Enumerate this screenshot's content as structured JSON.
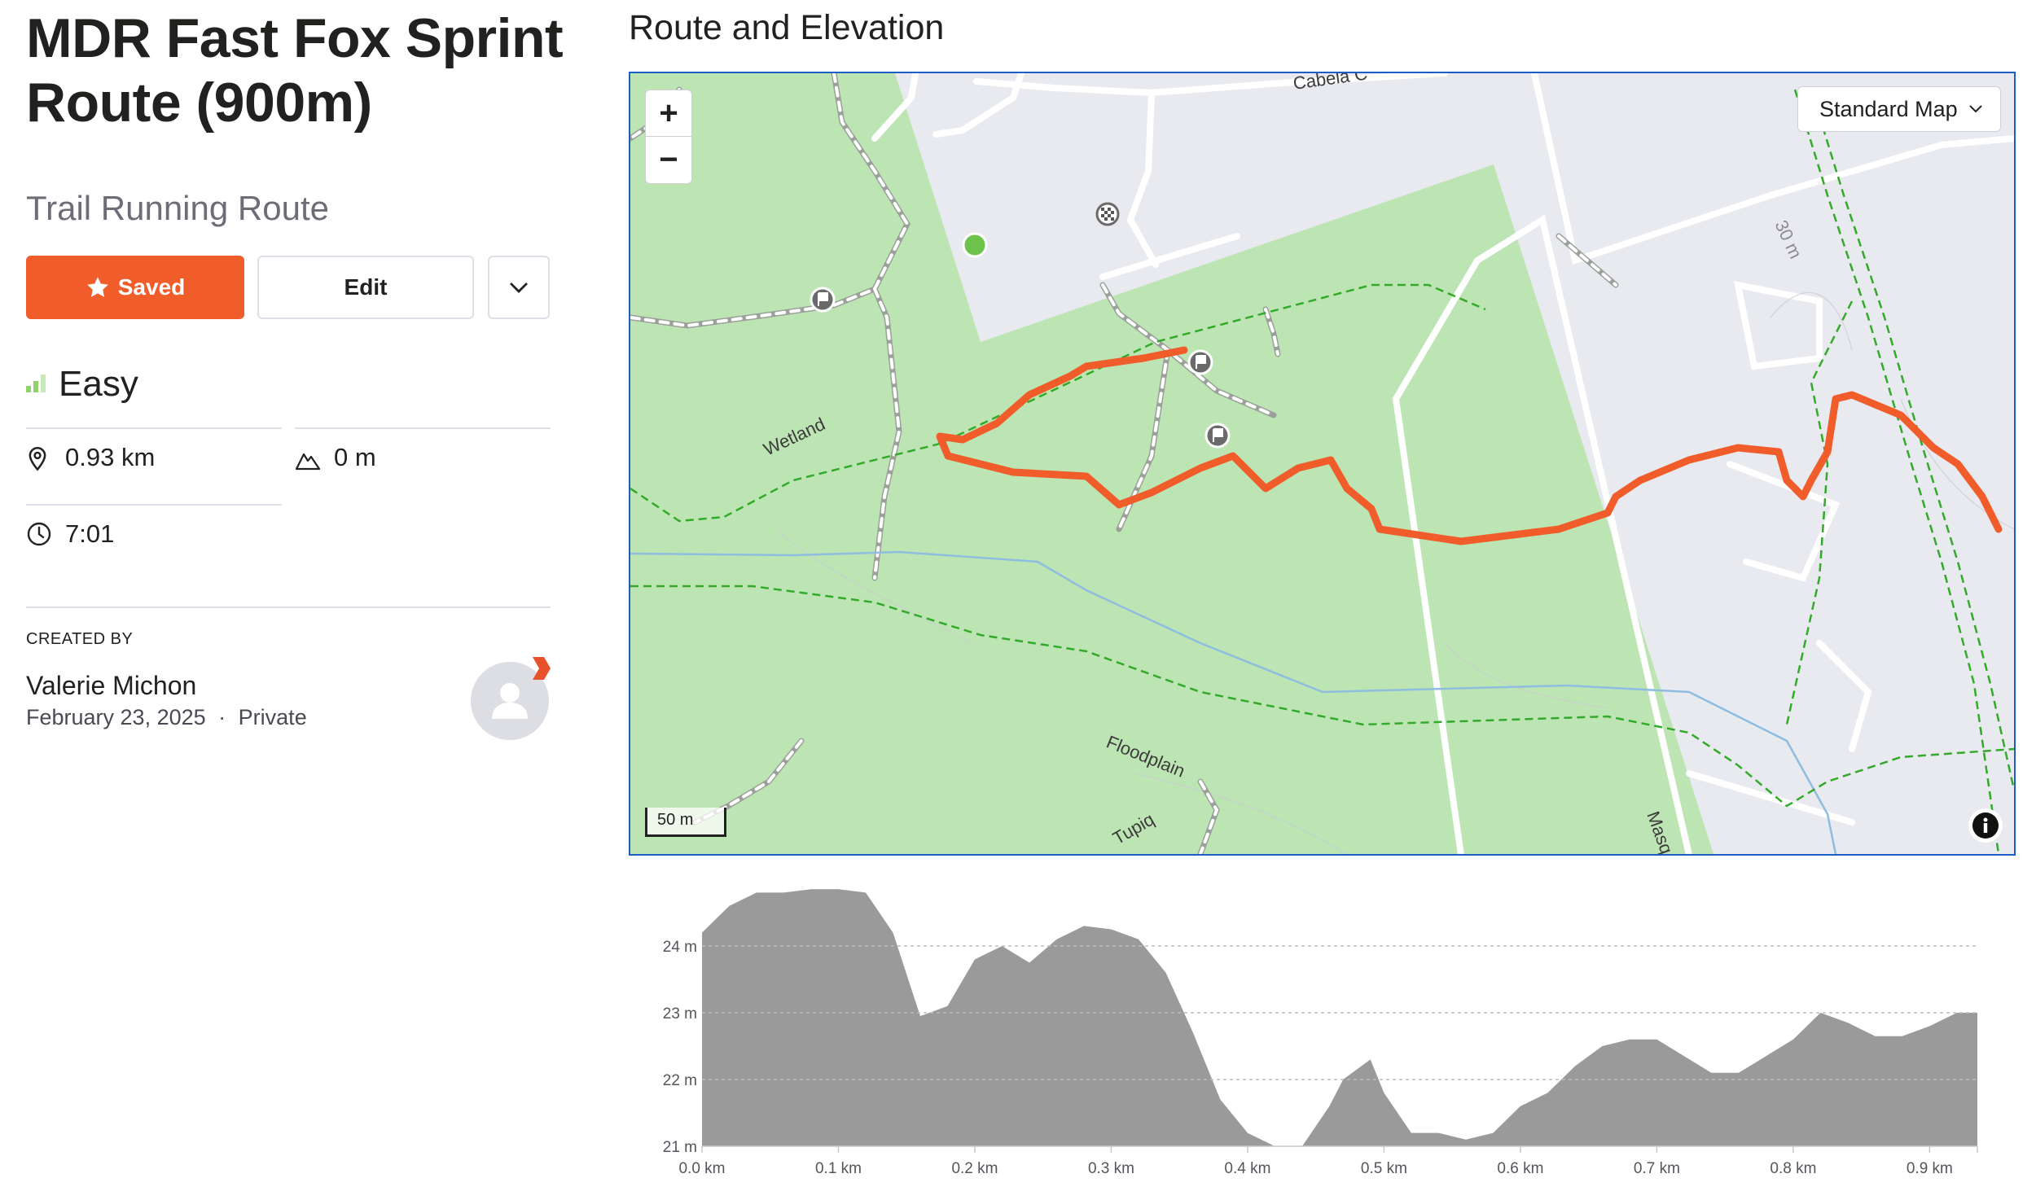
{
  "route": {
    "title": "MDR Fast Fox Sprint Route (900m)",
    "type": "Trail Running Route",
    "saved_label": "Saved",
    "edit_label": "Edit",
    "difficulty": "Easy",
    "distance": "0.93 km",
    "elevation_gain": "0 m",
    "time": "7:01"
  },
  "creator": {
    "label": "CREATED BY",
    "name": "Valerie Michon",
    "date": "February 23, 2025",
    "separator": "·",
    "visibility": "Private"
  },
  "section": {
    "title": "Route and Elevation"
  },
  "map": {
    "style": "Standard Map",
    "zoom_in": "+",
    "zoom_out": "−",
    "scale": "50 m",
    "info": "i",
    "labels": {
      "road_top": "Cabela C",
      "wetland": "Wetland",
      "floodplain": "Floodplain",
      "tupiq": "Tupiq",
      "masq": "Masq",
      "contour": "30 m"
    },
    "colors": {
      "park": "#bde5b3",
      "urban": "#e9eaf0",
      "route": "#f05d2b",
      "trail": "#33aa2a",
      "water": "#8fbde0"
    }
  },
  "chart_data": {
    "type": "area",
    "x": [
      0.0,
      0.02,
      0.04,
      0.06,
      0.08,
      0.1,
      0.12,
      0.14,
      0.16,
      0.18,
      0.2,
      0.22,
      0.24,
      0.26,
      0.28,
      0.3,
      0.32,
      0.34,
      0.36,
      0.38,
      0.4,
      0.42,
      0.44,
      0.46,
      0.47,
      0.49,
      0.5,
      0.52,
      0.54,
      0.56,
      0.58,
      0.6,
      0.62,
      0.64,
      0.66,
      0.68,
      0.7,
      0.72,
      0.74,
      0.76,
      0.78,
      0.8,
      0.82,
      0.84,
      0.86,
      0.88,
      0.9,
      0.92,
      0.935
    ],
    "y": [
      24.2,
      24.6,
      24.8,
      24.8,
      24.85,
      24.85,
      24.8,
      24.2,
      22.95,
      23.1,
      23.8,
      24.0,
      23.75,
      24.1,
      24.3,
      24.25,
      24.1,
      23.6,
      22.7,
      21.7,
      21.2,
      21.0,
      21.0,
      21.6,
      22.0,
      22.3,
      21.8,
      21.2,
      21.2,
      21.1,
      21.2,
      21.6,
      21.8,
      22.2,
      22.5,
      22.6,
      22.6,
      22.35,
      22.1,
      22.1,
      22.35,
      22.6,
      23.0,
      22.85,
      22.65,
      22.65,
      22.8,
      23.0,
      23.0
    ],
    "xlabel": "",
    "ylabel": "",
    "x_ticks": [
      "0.0 km",
      "0.1 km",
      "0.2 km",
      "0.3 km",
      "0.4 km",
      "0.5 km",
      "0.6 km",
      "0.7 km",
      "0.8 km",
      "0.9 km"
    ],
    "y_ticks": [
      "21 m",
      "22 m",
      "23 m",
      "24 m"
    ],
    "xlim": [
      0.0,
      0.935
    ],
    "ylim": [
      21.0,
      25.0
    ],
    "grid": true,
    "fill_color": "#9a9a9a"
  }
}
